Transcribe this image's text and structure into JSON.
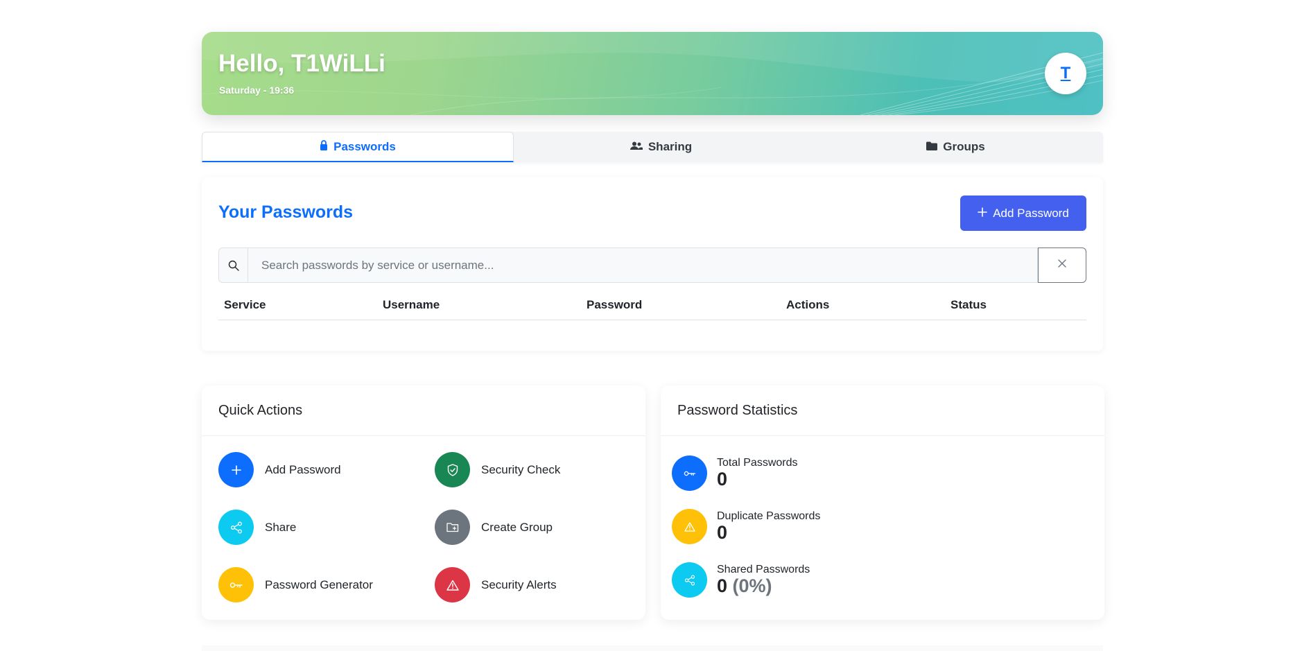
{
  "header": {
    "greeting": "Hello, T1WiLLi",
    "datetime": "Saturday - 19:36",
    "avatar_letter": "T"
  },
  "tabs": [
    {
      "label": "Passwords",
      "icon": "lock-icon",
      "active": true
    },
    {
      "label": "Sharing",
      "icon": "users-icon",
      "active": false
    },
    {
      "label": "Groups",
      "icon": "folder-icon",
      "active": false
    }
  ],
  "passwords": {
    "title": "Your Passwords",
    "add_label": "Add Password",
    "search_placeholder": "Search passwords by service or username...",
    "columns": [
      "Service",
      "Username",
      "Password",
      "Actions",
      "Status"
    ]
  },
  "quick_actions": {
    "title": "Quick Actions",
    "items": [
      {
        "label": "Add Password",
        "icon": "plus-icon",
        "color": "#0d6efd"
      },
      {
        "label": "Security Check",
        "icon": "shield-check-icon",
        "color": "#198754"
      },
      {
        "label": "Share",
        "icon": "share-icon",
        "color": "#0dcaf0"
      },
      {
        "label": "Create Group",
        "icon": "folder-plus-icon",
        "color": "#6c757d"
      },
      {
        "label": "Password Generator",
        "icon": "key-icon",
        "color": "#ffc107"
      },
      {
        "label": "Security Alerts",
        "icon": "warning-icon",
        "color": "#dc3545"
      }
    ]
  },
  "statistics": {
    "title": "Password Statistics",
    "items": [
      {
        "label": "Total Passwords",
        "value": "0",
        "icon": "key-icon",
        "color": "#0d6efd"
      },
      {
        "label": "Duplicate Passwords",
        "value": "0",
        "icon": "warning-icon",
        "color": "#ffc107"
      },
      {
        "label": "Shared Passwords",
        "value": "0",
        "extra": "(0%)",
        "icon": "share-icon",
        "color": "#0dcaf0"
      }
    ]
  }
}
